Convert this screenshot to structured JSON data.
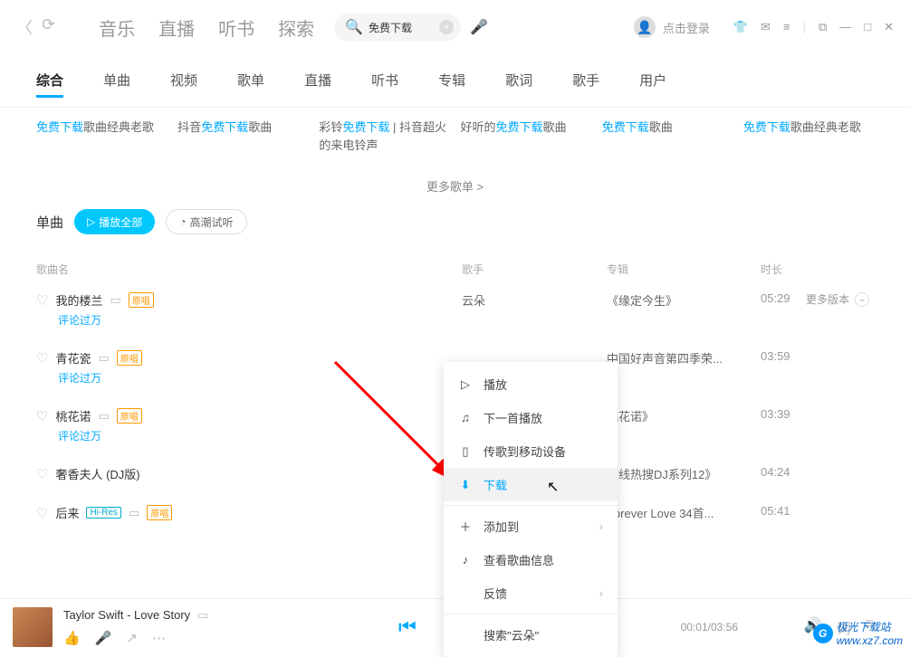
{
  "nav": {
    "music": "音乐",
    "live": "直播",
    "audiobook": "听书",
    "discover": "探索"
  },
  "search": {
    "query": "免费下载"
  },
  "login": "点击登录",
  "tabs": [
    "综合",
    "单曲",
    "视频",
    "歌单",
    "直播",
    "听书",
    "专辑",
    "歌词",
    "歌手",
    "用户"
  ],
  "active_tab": 0,
  "cards": [
    {
      "pre": "",
      "hl": "免费下载",
      "post": "歌曲经典老歌"
    },
    {
      "pre": "抖音",
      "hl": "免费下载",
      "post": "歌曲"
    },
    {
      "pre": "彩铃",
      "hl": "免费下载",
      "post": " | 抖音超火的来电铃声"
    },
    {
      "pre": "好听的",
      "hl": "免费下载",
      "post": "歌曲"
    },
    {
      "pre": "",
      "hl": "免费下载",
      "post": "歌曲"
    },
    {
      "pre": "",
      "hl": "免费下载",
      "post": "歌曲经典老歌"
    }
  ],
  "more": "更多歌单 >",
  "section": {
    "title": "单曲",
    "play_all": "播放全部",
    "climax": "高潮试听"
  },
  "columns": {
    "name": "歌曲名",
    "artist": "歌手",
    "album": "专辑",
    "duration": "时长"
  },
  "songs": [
    {
      "name": "我的楼兰",
      "badge": "原唱",
      "sub": "评论过万",
      "artist": "云朵",
      "album": "《缘定今生》",
      "dur": "05:29",
      "more": "更多版本"
    },
    {
      "name": "青花瓷",
      "badge": "原唱",
      "sub": "评论过万",
      "artist": "",
      "album": "中国好声音第四季荣...",
      "dur": "03:59"
    },
    {
      "name": "桃花诺",
      "badge": "原唱",
      "sub": "评论过万",
      "artist": "",
      "album": "桃花诺》",
      "dur": "03:39"
    },
    {
      "name": "奢香夫人 (DJ版)",
      "badge": "",
      "sub": "",
      "artist": "",
      "album": "在线热搜DJ系列12》",
      "dur": "04:24"
    },
    {
      "name": "后来",
      "badge": "原唱",
      "hires": "Hi-Res",
      "sub": "",
      "artist": "",
      "album": "Forever Love 34首...",
      "dur": "05:41"
    }
  ],
  "ctx": {
    "play": "播放",
    "next": "下一首播放",
    "send": "传歌到移动设备",
    "download": "下载",
    "addto": "添加到",
    "info": "查看歌曲信息",
    "feedback": "反馈",
    "search": "搜索\"云朵\""
  },
  "player": {
    "title": "Taylor Swift - Love Story",
    "time": "00:01/03:56"
  },
  "watermark": {
    "name": "极光下载站",
    "url": "www.xz7.com"
  }
}
